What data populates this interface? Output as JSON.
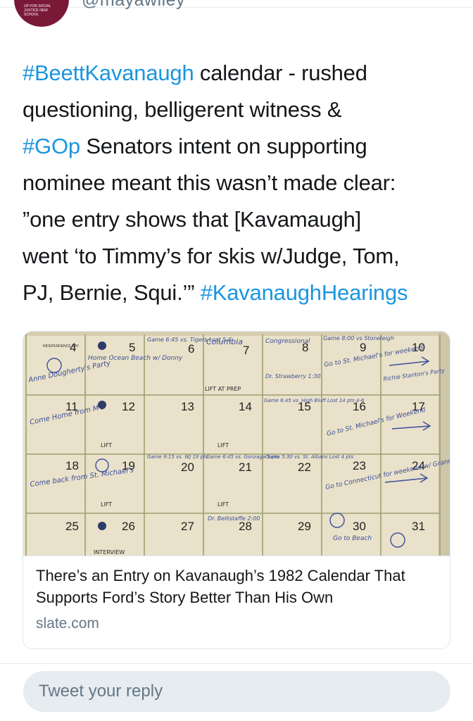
{
  "header": {
    "handle": "@mayawiley",
    "avatar_text": "UP FOR SOCIAL JUSTICE NEW SCHOOL"
  },
  "tweet": {
    "line1_tag": "#BeettKavanaugh",
    "line1_text": " calendar - rushed",
    "line2": "questioning, belligerent witness &",
    "line3_tag": "#GOp",
    "line3_text": " Senators intent on supporting",
    "line4": "nominee meant this wasn’t made clear:",
    "line5": "”one entry shows that [Kavamaugh]",
    "line6": "went ‘to Timmy’s for skis w/Judge, Tom,",
    "line7_text": "PJ, Bernie, Squi.’” ",
    "line7_tag": "#KavanaughHearings"
  },
  "card": {
    "title": "There’s an Entry on Kavanaugh’s 1982 Calendar That Supports Ford’s Story Better Than His Own",
    "domain": "slate.com",
    "calendar": {
      "days": [
        "4",
        "5",
        "6",
        "7",
        "8",
        "9",
        "10",
        "11",
        "12",
        "13",
        "14",
        "15",
        "16",
        "17",
        "18",
        "19",
        "20",
        "21",
        "22",
        "23",
        "24",
        "25",
        "26",
        "27",
        "28",
        "29",
        "30",
        "31"
      ],
      "independence": "INDEPENDENCE DAY",
      "notes": {
        "n4": "Anne Dougherty's Party",
        "n5": "Home Ocean Beach w/ Donny",
        "n6": "Game 6:45 vs. Tigers Lost 5-6",
        "n7": "Columbia",
        "n8": "Congressional",
        "n9": "Game 8:00 vs Stoneleigh",
        "n9b": "Go to St. Michael's for weekend",
        "n10": "Richie Stanton's Party",
        "n11": "Come Home from M's",
        "n14": "LIFT AT PREP",
        "n14b": "Dr. Strawberry 1:30",
        "n15": "Game 6:45 vs. High Bluff Lost 14 pts 4-6",
        "n16": "Go to St. Michael's for Weekend",
        "n18": "Come back from St. Michael's",
        "n20": "Game 9:15 vs. WJ 19 pts",
        "n21": "Game 6:45 vs. Gonzaga 5 pts",
        "n22": "Game 5:30 vs. St. Albans Lost 4 pts",
        "n23": "Go to Connecticut for weekend w/ Granny",
        "n28": "Dr. Bellistaffe 2:00",
        "n30": "Go to Beach",
        "lift": "LIFT",
        "interview": "INTERVIEW"
      }
    }
  },
  "reply": {
    "placeholder": "Tweet your reply"
  },
  "colors": {
    "link": "#1b95e0",
    "text": "#14171a",
    "muted": "#657786",
    "border": "#e1e8ed",
    "ink": "#3d4f9a",
    "paper": "#e9e1c9"
  }
}
